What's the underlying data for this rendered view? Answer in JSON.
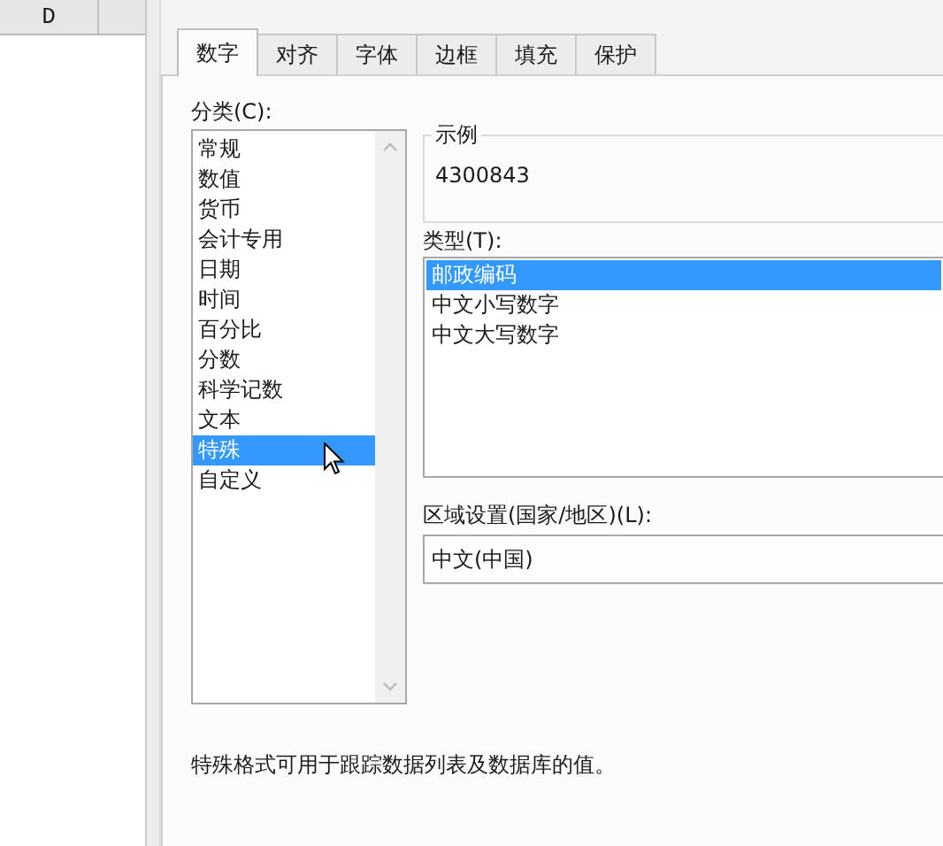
{
  "sheet": {
    "column_header": "D"
  },
  "tabs": [
    {
      "label": "数字",
      "selected": true
    },
    {
      "label": "对齐",
      "selected": false
    },
    {
      "label": "字体",
      "selected": false
    },
    {
      "label": "边框",
      "selected": false
    },
    {
      "label": "填充",
      "selected": false
    },
    {
      "label": "保护",
      "selected": false
    }
  ],
  "category": {
    "label": "分类(C):",
    "items": [
      {
        "label": "常规",
        "selected": false
      },
      {
        "label": "数值",
        "selected": false
      },
      {
        "label": "货币",
        "selected": false
      },
      {
        "label": "会计专用",
        "selected": false
      },
      {
        "label": "日期",
        "selected": false
      },
      {
        "label": "时间",
        "selected": false
      },
      {
        "label": "百分比",
        "selected": false
      },
      {
        "label": "分数",
        "selected": false
      },
      {
        "label": "科学记数",
        "selected": false
      },
      {
        "label": "文本",
        "selected": false
      },
      {
        "label": "特殊",
        "selected": true
      },
      {
        "label": "自定义",
        "selected": false
      }
    ]
  },
  "sample": {
    "label": "示例",
    "value": "4300843"
  },
  "type": {
    "label": "类型(T):",
    "items": [
      {
        "label": "邮政编码",
        "selected": true
      },
      {
        "label": "中文小写数字",
        "selected": false
      },
      {
        "label": "中文大写数字",
        "selected": false
      }
    ]
  },
  "locale": {
    "label": "区域设置(国家/地区)(L):",
    "value": "中文(中国)"
  },
  "description": "特殊格式可用于跟踪数据列表及数据库的值。"
}
